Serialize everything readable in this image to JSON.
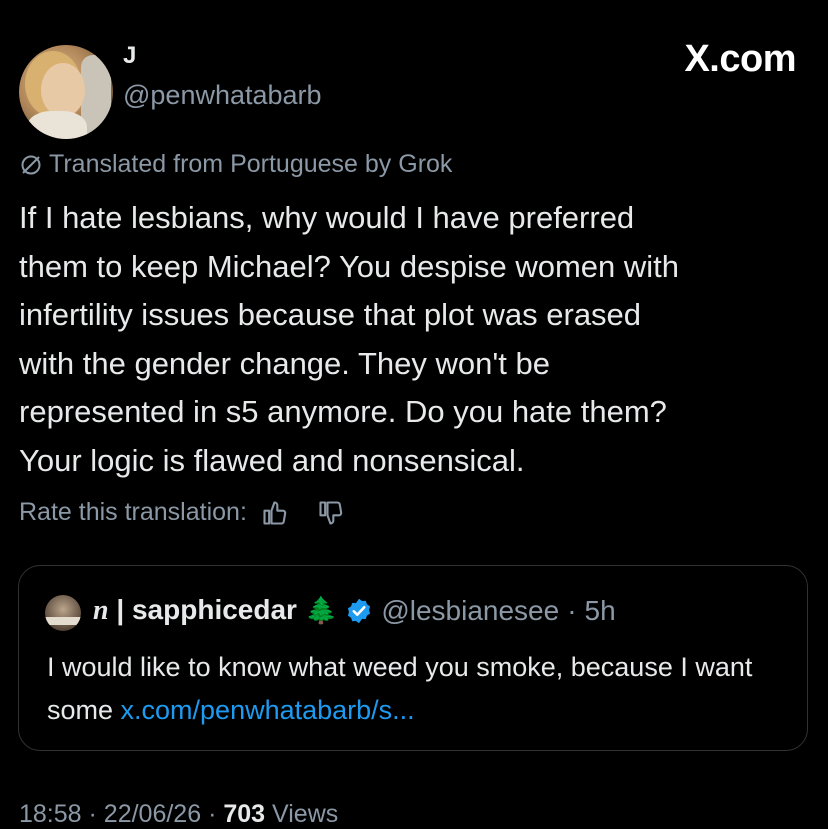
{
  "author": {
    "display_name": "J",
    "handle": "@penwhatabarb"
  },
  "brand": "X.com",
  "translation_note": "Translated from Portuguese by Grok",
  "post_text": "If I hate lesbians, why would I have preferred\nthem to keep Michael? You despise women with\ninfertility issues because that plot was erased\nwith the gender change. They won't be\nrepresented in s5 anymore. Do you hate them?\nYour logic is flawed and nonsensical.",
  "rate_label": "Rate this translation:",
  "icons": {
    "translate": "slashed-circle-icon",
    "thumbs_up": "thumbs-up-icon",
    "thumbs_down": "thumbs-down-icon",
    "verified": "verified-badge-icon"
  },
  "quote": {
    "name_prefix": "n",
    "name_separator": "|",
    "name": "sapphicedar",
    "emoji": "🌲",
    "handle": "@lesbianesee",
    "time": "5h",
    "text": "I would like to know what weed you smoke, because I want some ",
    "link": "x.com/penwhatabarb/s..."
  },
  "footer": {
    "time": "18:58",
    "date": "22/06/26",
    "views_count": "703",
    "views_label": "Views"
  },
  "colors": {
    "background": "#000000",
    "text": "#e7e9ea",
    "muted": "#8b98a5",
    "link": "#1d9bf0",
    "border": "#2f3336"
  }
}
